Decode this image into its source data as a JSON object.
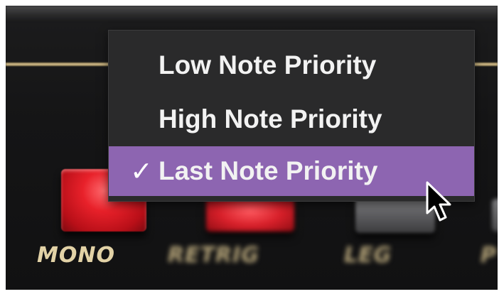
{
  "menu": {
    "items": [
      {
        "label": "Low Note Priority",
        "checked": false
      },
      {
        "label": "High Note Priority",
        "checked": false
      },
      {
        "label": "Last Note Priority",
        "checked": true
      }
    ],
    "check_glyph": "✓",
    "highlight_color": "#8d65b1"
  },
  "buttons": {
    "mono": {
      "label": "MONO",
      "color": "#e8212a"
    },
    "retrig": {
      "label": "RETRIG",
      "color": "#d8202a"
    },
    "leg": {
      "label": "LEG",
      "color": "#606063"
    },
    "edge": {
      "label": "P"
    }
  },
  "icons": {
    "cursor": "mouse-pointer-icon",
    "check": "check-icon"
  }
}
